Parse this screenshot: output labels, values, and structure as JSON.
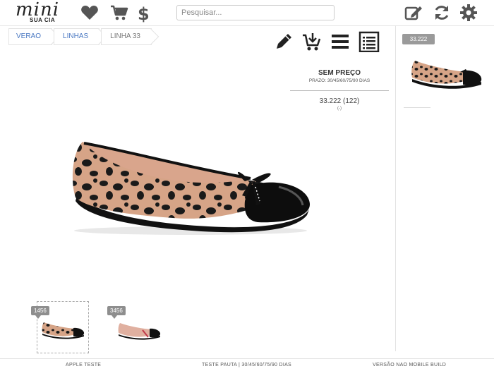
{
  "brand": {
    "logo_text": "mini",
    "logo_sub": "SUA CIA"
  },
  "topbar": {
    "icons": [
      "heart-icon",
      "cart-icon",
      "dollar-icon",
      "edit-icon",
      "refresh-icon",
      "gear-icon"
    ],
    "search": {
      "placeholder": "Pesquisar...",
      "value": ""
    }
  },
  "breadcrumb": [
    "VERAO",
    "LINHAS",
    "LINHA 33"
  ],
  "toolbar": {
    "icons": [
      "pencil-icon",
      "add-to-cart-icon",
      "menu-icon",
      "list-icon"
    ]
  },
  "price": {
    "title": "SEM PREÇO",
    "terms": "PRAZO: 30/45/60/75/90 DIAS",
    "code": "33.222 (122)",
    "note": "(-)"
  },
  "sidebar": {
    "badge": "33.222"
  },
  "thumbnails": [
    {
      "badge": "1456",
      "variant": "leopard"
    },
    {
      "badge": "3456",
      "variant": "nude"
    }
  ],
  "footer": {
    "left": "APPLE TESTE",
    "center": "TESTE PAUTA | 30/45/60/75/90 DIAS",
    "right": "VERSÃO NAO MOBILE BUILD"
  },
  "colors": {
    "link": "#4a78c2",
    "badge": "#9a9a9a",
    "leopard_base": "#d8a58a",
    "patent": "#111111"
  }
}
